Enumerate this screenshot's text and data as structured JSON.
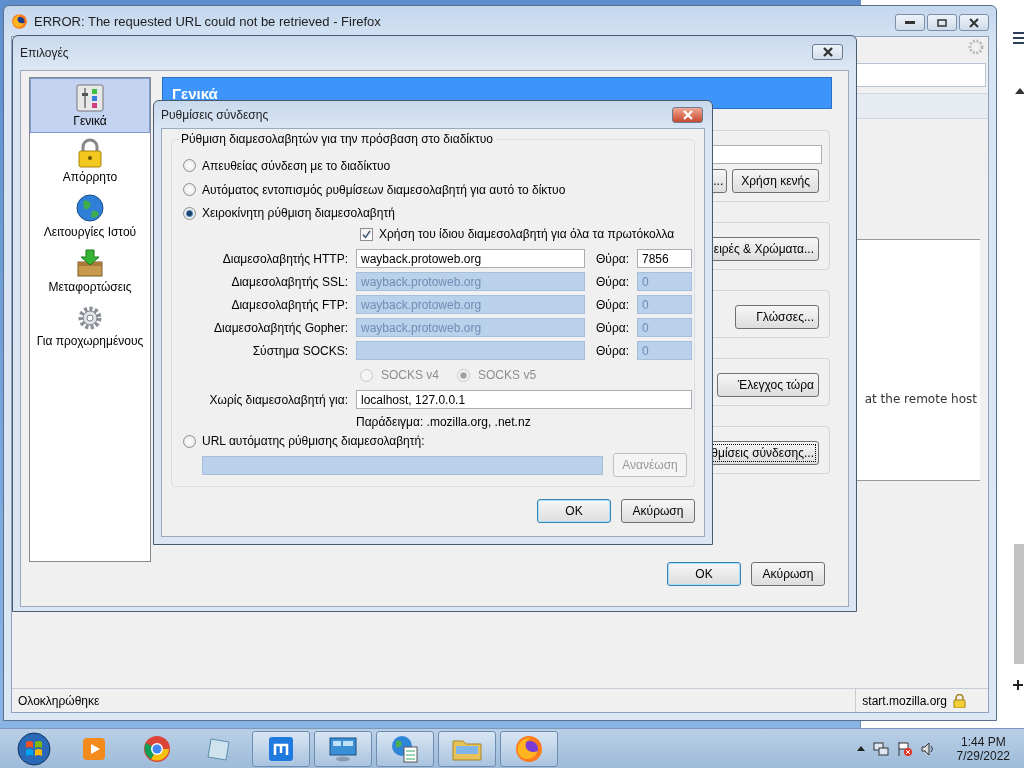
{
  "browser_window": {
    "title": "ERROR: The requested URL could not be retrieved - Firefox",
    "page_text": "at the remote host",
    "status_bar": {
      "text": "Ολοκληρώθηκε",
      "url": "start.mozilla.org"
    }
  },
  "options_dialog": {
    "title": "Επιλογές",
    "sidebar": [
      {
        "label": "Γενικά",
        "selected": true
      },
      {
        "label": "Απόρρητο",
        "selected": false
      },
      {
        "label": "Λειτουργίες Ιστού",
        "selected": false
      },
      {
        "label": "Μεταφορτώσεις",
        "selected": false
      },
      {
        "label": "Για προχωρημένους",
        "selected": false
      }
    ],
    "pane_title": "Γενικά",
    "groups": [
      {
        "kind": "field_row",
        "buttons": [
          "...",
          "Χρήση κενής"
        ],
        "focused": false
      },
      {
        "kind": "button_row",
        "buttons": [
          "ειρές & Χρώματα..."
        ],
        "focused": false
      },
      {
        "kind": "button_row",
        "buttons": [
          "Γλώσσες..."
        ],
        "focused": false
      },
      {
        "kind": "button_row",
        "buttons": [
          "Έλεγχος τώρα"
        ],
        "focused": false
      },
      {
        "kind": "button_row",
        "buttons": [
          "θμίσεις σύνδεσης..."
        ],
        "focused": true
      }
    ],
    "buttons": [
      {
        "label": "OK",
        "default": true
      },
      {
        "label": "Ακύρωση",
        "default": false
      }
    ]
  },
  "connection_dialog": {
    "title": "Ρυθμίσεις σύνδεσης",
    "group_title": "Ρύθμιση διαμεσολαβητών για την πρόσβαση στο διαδίκτυο",
    "modes": [
      {
        "label": "Απευθείας σύνδεση με το διαδίκτυο",
        "selected": false
      },
      {
        "label": "Αυτόματος εντοπισμός ρυθμίσεων διαμεσολαβητή για αυτό το δίκτυο",
        "selected": false
      },
      {
        "label": "Χειροκίνητη ρύθμιση διαμεσολαβητή",
        "selected": true
      }
    ],
    "same_proxy": {
      "label": "Χρήση του ίδιου διαμεσολαβητή για όλα τα πρωτόκολλα",
      "checked": true
    },
    "proxies": [
      {
        "label": "Διαμεσολαβητής HTTP:",
        "value": "wayback.protoweb.org",
        "port_label": "Θύρα:",
        "port": "7856",
        "disabled": false
      },
      {
        "label": "Διαμεσολαβητής SSL:",
        "value": "wayback.protoweb.org",
        "port_label": "Θύρα:",
        "port": "0",
        "disabled": true
      },
      {
        "label": "Διαμεσολαβητής FTP:",
        "value": "wayback.protoweb.org",
        "port_label": "Θύρα:",
        "port": "0",
        "disabled": true
      },
      {
        "label": "Διαμεσολαβητής Gopher:",
        "value": "wayback.protoweb.org",
        "port_label": "Θύρα:",
        "port": "0",
        "disabled": true
      },
      {
        "label": "Σύστημα SOCKS:",
        "port_label": "Θύρα:",
        "port": "0",
        "disabled": true
      }
    ],
    "socks_versions": [
      {
        "label": "SOCKS v4",
        "selected": false,
        "disabled": true
      },
      {
        "label": "SOCKS v5",
        "selected": true,
        "disabled": true
      }
    ],
    "no_proxy": {
      "label": "Χωρίς διαμεσολαβητή για:",
      "value": "localhost, 127.0.0.1"
    },
    "example": "Παράδειγμα: .mozilla.org, .net.nz",
    "auto_url": {
      "label": "URL αυτόματης ρύθμισης διαμεσολαβητή:",
      "selected": false,
      "disabled": true,
      "reload": "Ανανέωση"
    },
    "buttons": [
      {
        "label": "OK",
        "default": true
      },
      {
        "label": "Ακύρωση",
        "default": false
      }
    ]
  },
  "taskbar": {
    "time": "1:44 PM",
    "date": "7/29/2022"
  }
}
